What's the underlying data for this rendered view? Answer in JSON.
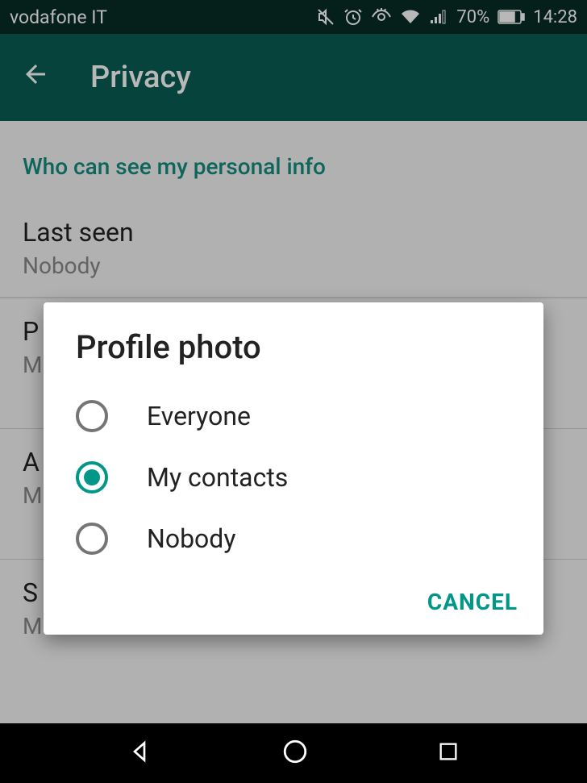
{
  "status_bar": {
    "carrier": "vodafone IT",
    "battery": "70%",
    "time": "14:28"
  },
  "toolbar": {
    "title": "Privacy"
  },
  "section": {
    "header": "Who can see my personal info"
  },
  "settings": {
    "last_seen": {
      "title": "Last seen",
      "value": "Nobody"
    },
    "profile_photo": {
      "title_partial": "P",
      "value_partial": "M"
    },
    "about": {
      "title_partial": "A",
      "value_partial": "M"
    },
    "status": {
      "title_partial": "S",
      "value_partial": "M"
    }
  },
  "dialog": {
    "title": "Profile photo",
    "options": [
      {
        "label": "Everyone",
        "selected": false
      },
      {
        "label": "My contacts",
        "selected": true
      },
      {
        "label": "Nobody",
        "selected": false
      }
    ],
    "cancel": "CANCEL"
  }
}
